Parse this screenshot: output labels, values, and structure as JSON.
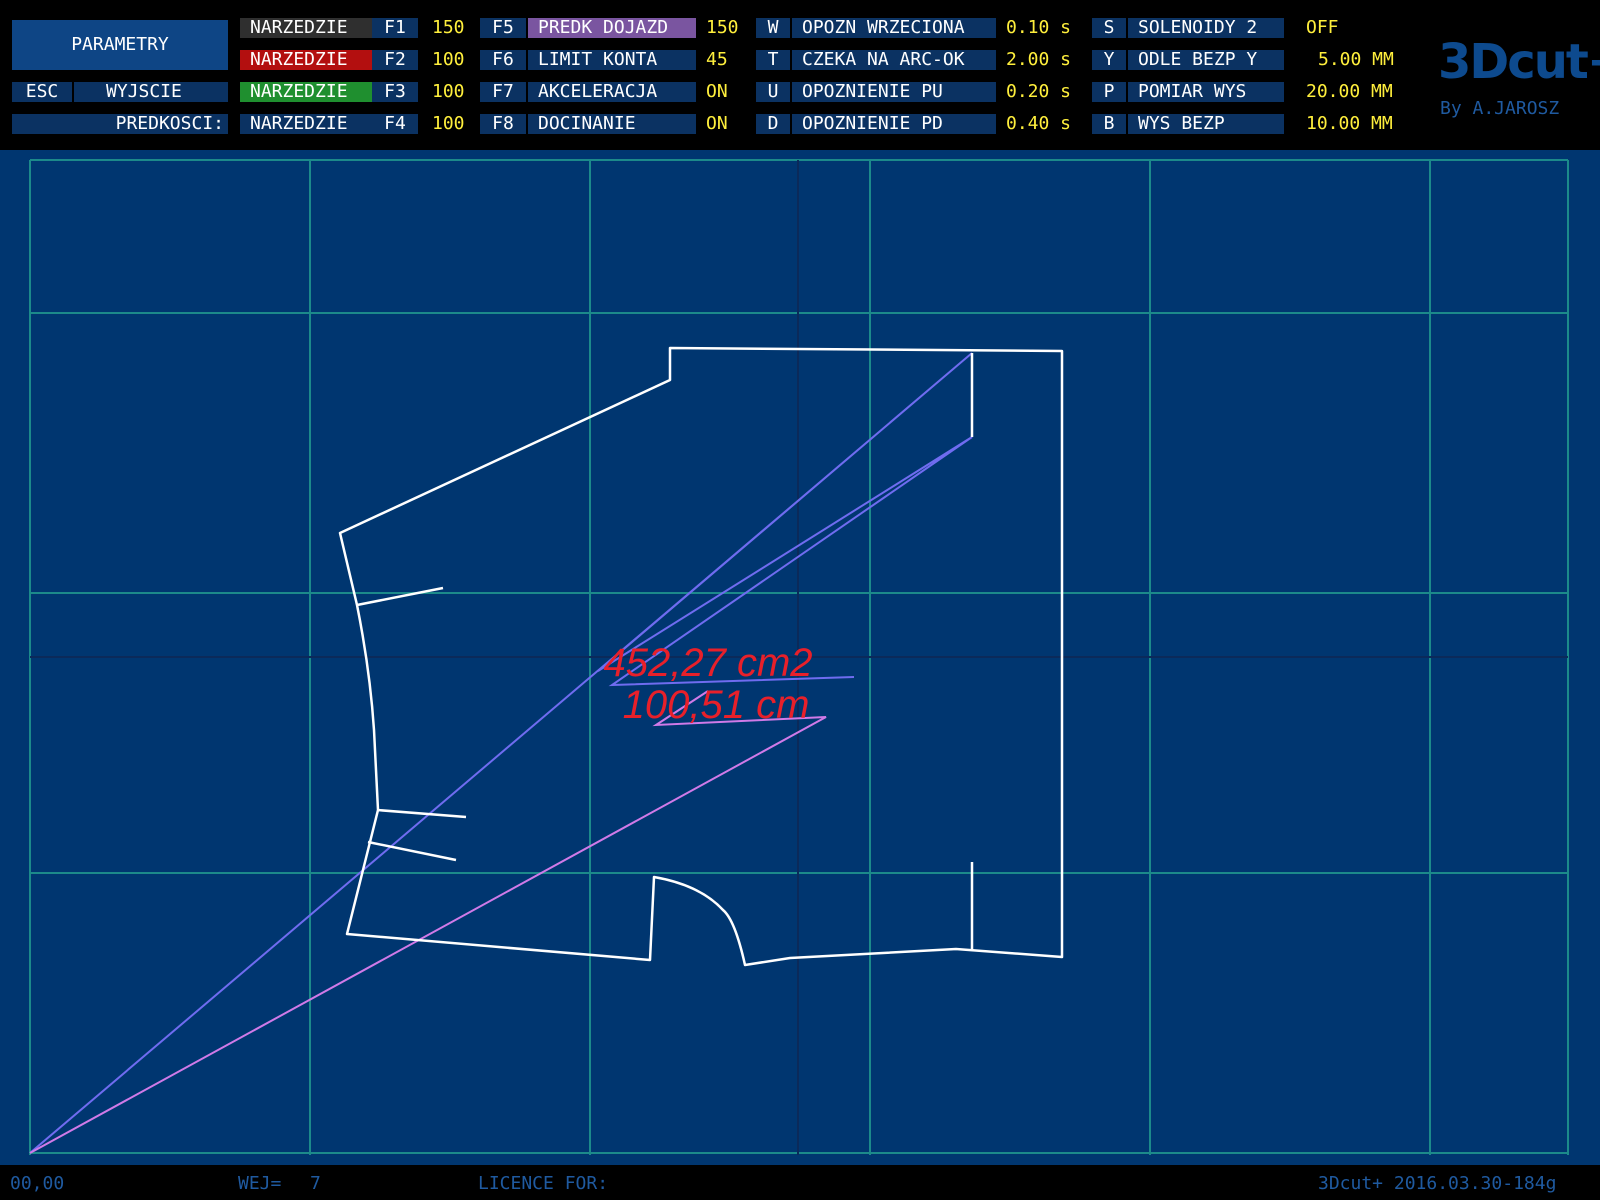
{
  "header": {
    "param_button": "PARAMETRY",
    "esc_key": "ESC",
    "esc_label": "WYJSCIE",
    "speeds_label": "PREDKOSCI:",
    "tools": [
      {
        "label": "NARZEDZIE",
        "key": "F1",
        "value": "150",
        "color": "#2f2f2f"
      },
      {
        "label": "NARZEDZIE",
        "key": "F2",
        "value": "100",
        "color": "#b30f0f"
      },
      {
        "label": "NARZEDZIE",
        "key": "F3",
        "value": "100",
        "color": "#1f8f2f"
      },
      {
        "label": "NARZEDZIE",
        "key": "F4",
        "value": "100",
        "color": "#0b3262"
      }
    ],
    "fparams": [
      {
        "key": "F5",
        "label": "PREDK DOJAZD",
        "value": "150"
      },
      {
        "key": "F6",
        "label": "LIMIT KONTA",
        "value": "45"
      },
      {
        "key": "F7",
        "label": "AKCELERACJA",
        "value": "ON"
      },
      {
        "key": "F8",
        "label": "DOCINANIE",
        "value": "ON"
      }
    ],
    "timings": [
      {
        "key": "W",
        "label": "OPOZN WRZECIONA",
        "value": "0.10 s"
      },
      {
        "key": "T",
        "label": "CZEKA NA ARC-OK",
        "value": "2.00 s"
      },
      {
        "key": "U",
        "label": "OPOZNIENIE PU",
        "value": "0.20 s"
      },
      {
        "key": "D",
        "label": "OPOZNIENIE PD",
        "value": "0.40 s"
      }
    ],
    "settings": [
      {
        "key": "S",
        "label": "SOLENOIDY 2",
        "value": "OFF"
      },
      {
        "key": "Y",
        "label": "ODLE BEZP Y",
        "value": "5.00 MM"
      },
      {
        "key": "P",
        "label": "POMIAR WYS",
        "value": "20.00 MM"
      },
      {
        "key": "B",
        "label": "WYS BEZP",
        "value": "10.00 MM"
      }
    ],
    "logo": "3Dcut+",
    "logo_by": "By A.JAROSZ"
  },
  "canvas": {
    "area_text": "452,27 cm2",
    "length_text": "100,51 cm",
    "colors": {
      "background": "#003670",
      "grid": "#1c8a8a",
      "axis": "#0b2a5a",
      "shape": "#ffffff",
      "path_blue": "#6f6cf0",
      "path_pink": "#d07ae8",
      "measure_text": "#e8202a"
    }
  },
  "footer": {
    "coords": "00,00",
    "entries_label": "WEJ=",
    "entries_value": "7",
    "licence_label": "LICENCE FOR:",
    "version": "3Dcut+ 2016.03.30-184g"
  }
}
